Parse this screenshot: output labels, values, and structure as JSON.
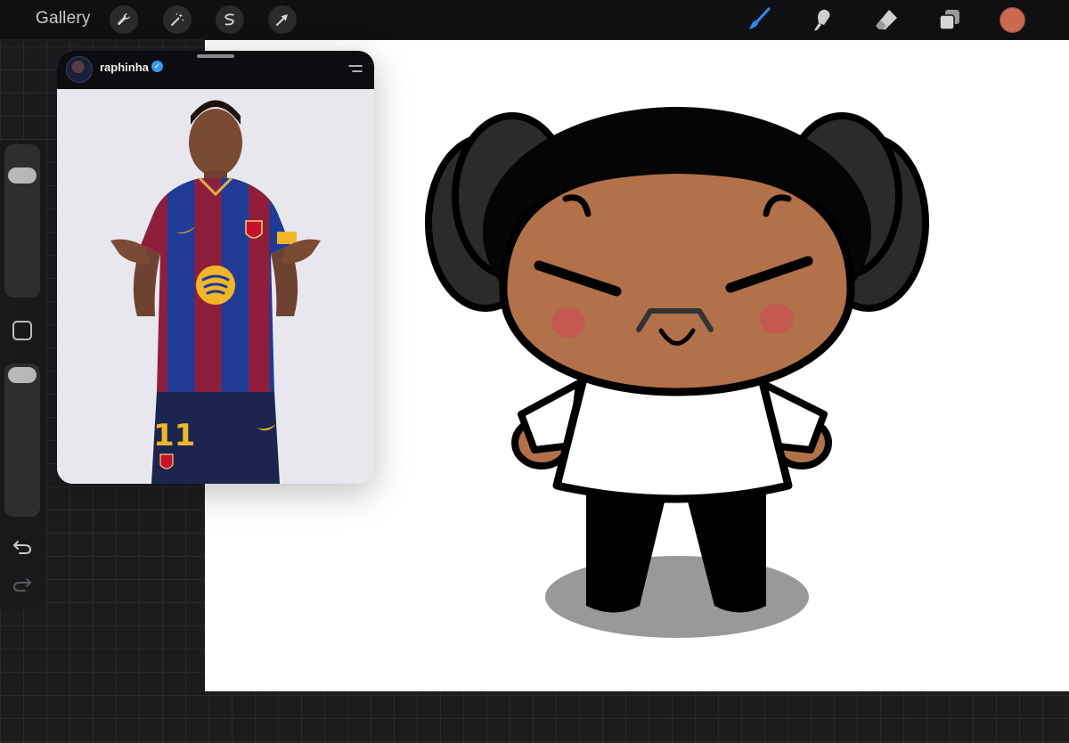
{
  "toolbar": {
    "gallery_label": "Gallery",
    "left_tools": [
      "wrench-icon",
      "magic-wand-icon",
      "selection-icon",
      "transform-arrow-icon"
    ],
    "right_tools": [
      "brush-icon",
      "smudge-icon",
      "eraser-icon",
      "layers-icon"
    ],
    "active_tool": "brush-icon",
    "accent_color": "#2f8cf2",
    "current_color": "#c76a4e"
  },
  "sidebar": {
    "brush_size_level": 0.96,
    "opacity_level": 0.96,
    "buttons": [
      "modify-button",
      "undo-icon",
      "redo-icon"
    ]
  },
  "reference": {
    "username": "raphinha",
    "verified": true,
    "jersey_number": "11"
  },
  "colors": {
    "skin": "#b27148",
    "hair": "#050505",
    "hair_buns": "#2b2b2b",
    "cheeks": "#c4594f",
    "shadow": "#97999b",
    "shirt": "#ffffff"
  }
}
